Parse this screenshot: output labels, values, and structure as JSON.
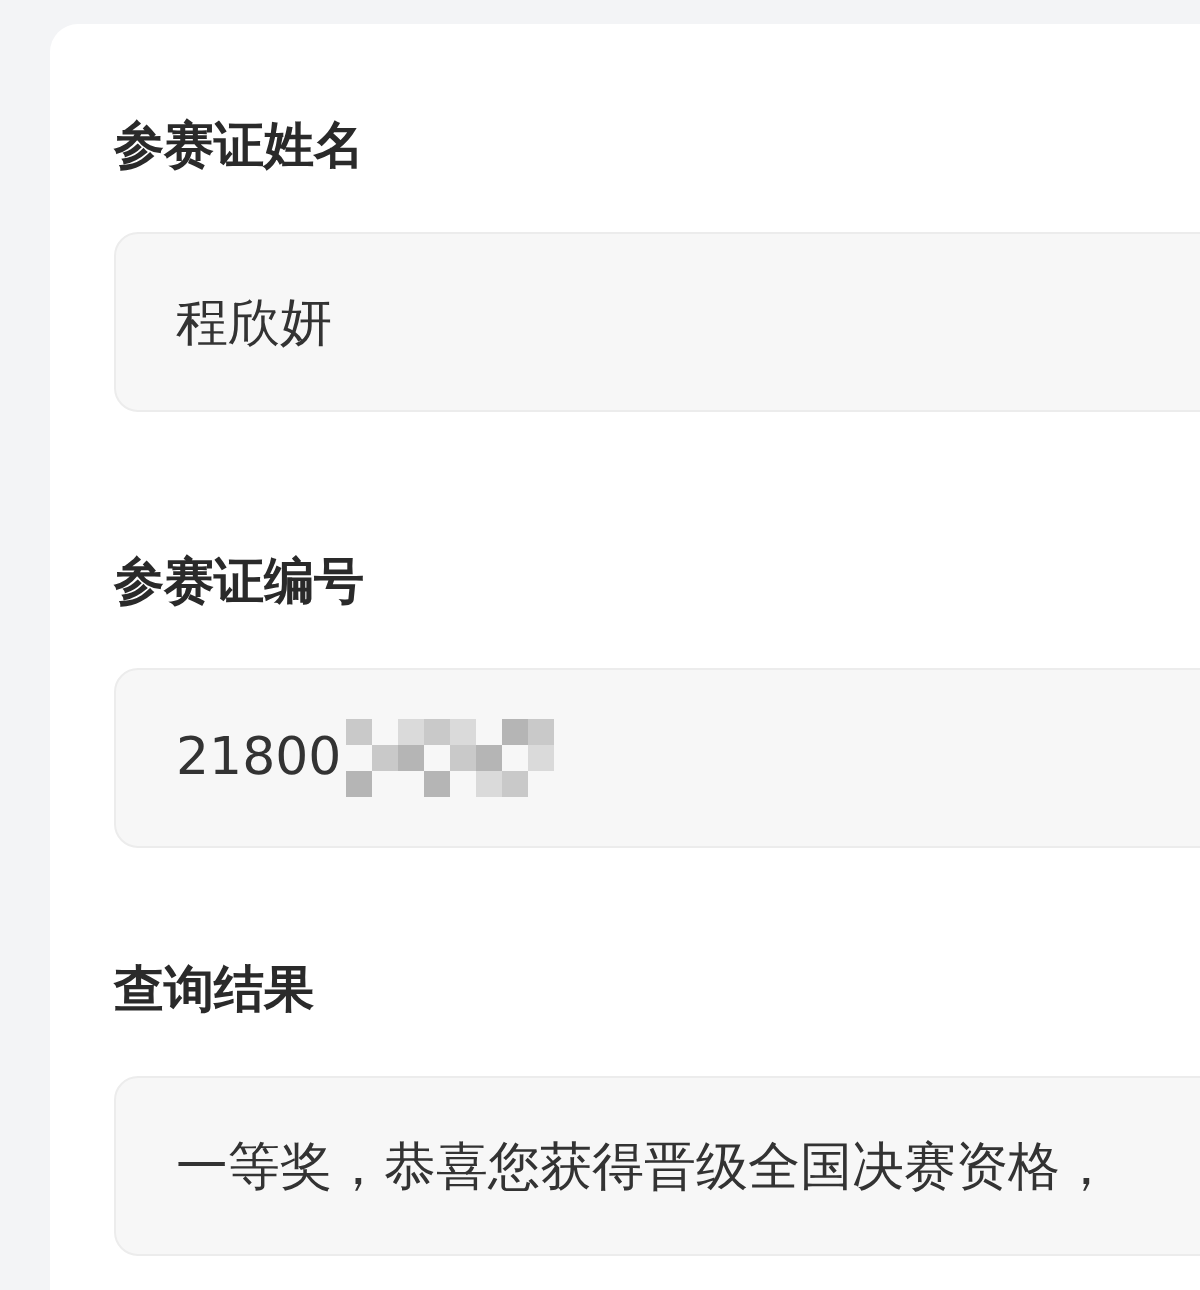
{
  "fields": [
    {
      "label": "参赛证姓名",
      "value": "程欣妍",
      "masked": false
    },
    {
      "label": "参赛证编号",
      "value": "21800",
      "masked": true
    },
    {
      "label": "查询结果",
      "value": "一等奖，恭喜您获得晋级全国决赛资格，",
      "masked": false
    }
  ]
}
